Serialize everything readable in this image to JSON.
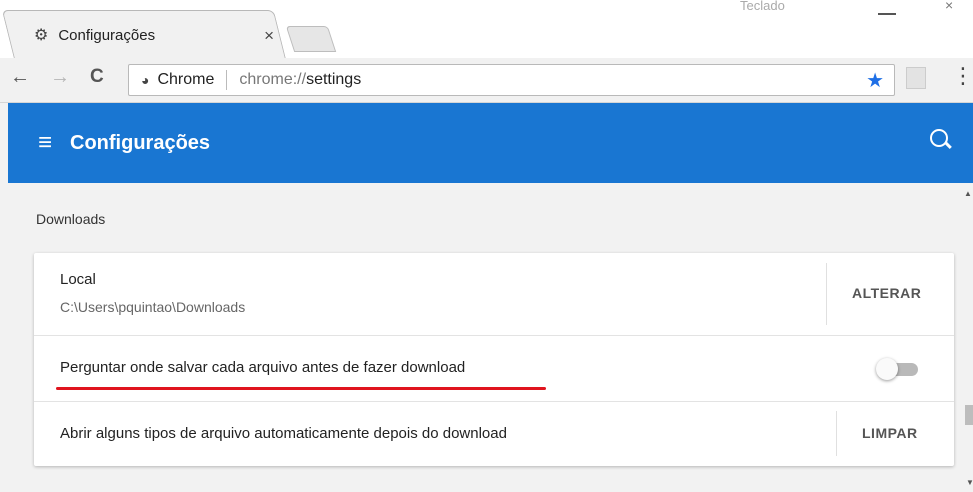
{
  "browser": {
    "tab_title": "Configurações",
    "tab_close": "×",
    "window_caption": "Teclado",
    "window_close": "×",
    "omnibox_chip": "Chrome",
    "url_scheme": "chrome://",
    "url_host": "settings",
    "icons": {
      "back": "←",
      "forward": "→",
      "reload": "C",
      "star": "★",
      "menu": "⋮"
    }
  },
  "appbar": {
    "title": "Configurações",
    "menu_icon": "≡",
    "color": "#1976d2"
  },
  "downloads": {
    "section_title": "Downloads",
    "location": {
      "label": "Local",
      "path": "C:\\Users\\pquintao\\Downloads",
      "button": "ALTERAR"
    },
    "ask_where": {
      "label": "Perguntar onde salvar cada arquivo antes de fazer download",
      "enabled": false,
      "highlight_color": "#e0141e"
    },
    "auto_open": {
      "label": "Abrir alguns tipos de arquivo automaticamente depois do download",
      "button": "LIMPAR"
    }
  }
}
